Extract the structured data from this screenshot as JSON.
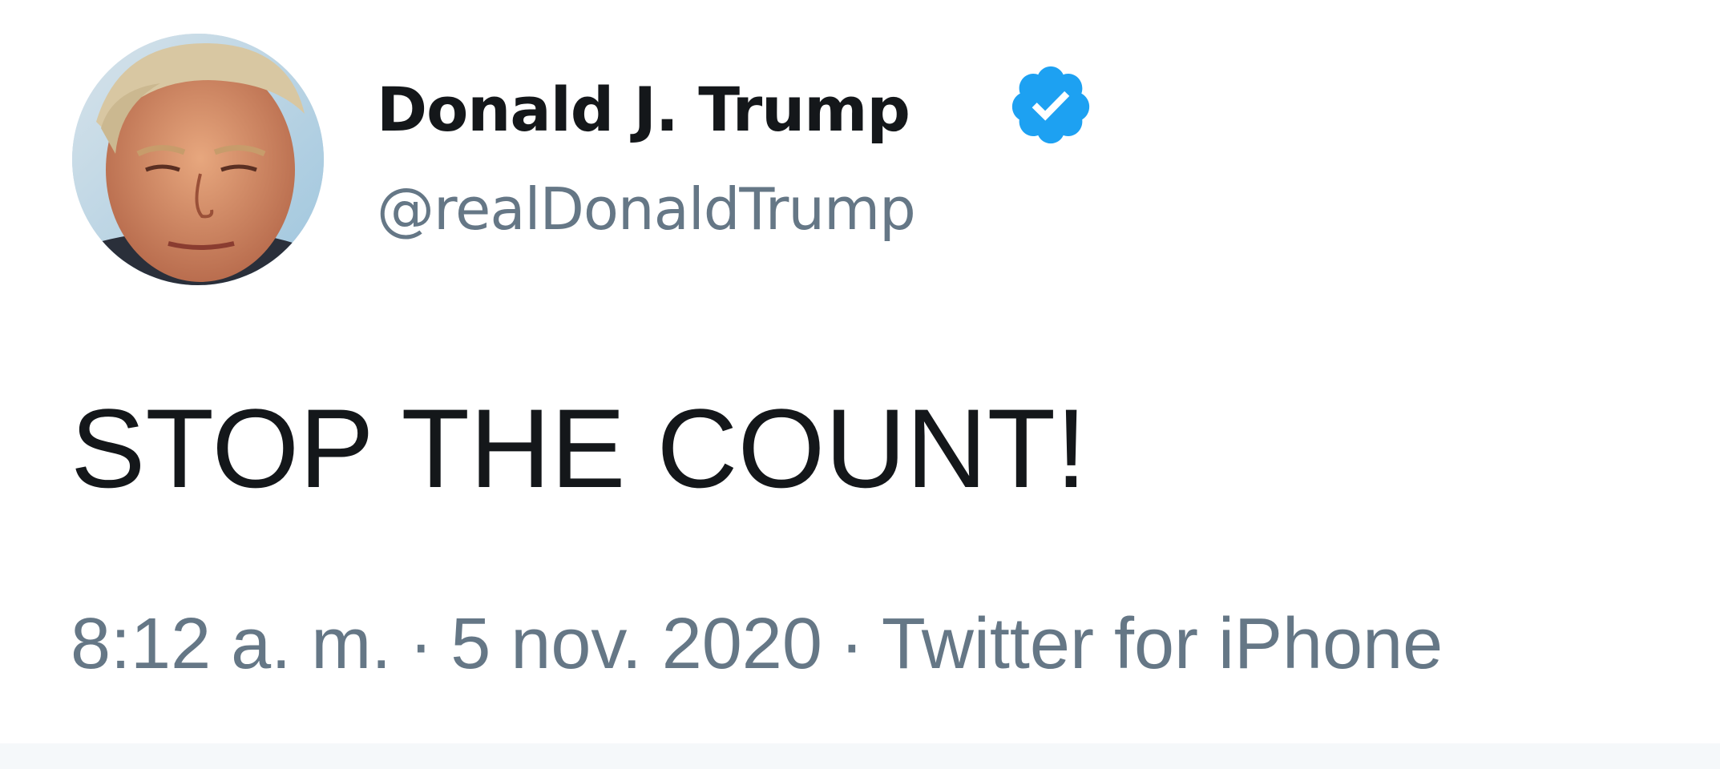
{
  "author": {
    "display_name": "Donald J. Trump",
    "handle": "@realDonaldTrump",
    "verified": true,
    "verified_badge_icon": "verified-badge-icon",
    "avatar_icon": "profile-photo"
  },
  "tweet": {
    "text": "STOP THE COUNT!",
    "time": "8:12 a. m.",
    "date": "5 nov. 2020",
    "source": "Twitter for iPhone",
    "separator": "·"
  },
  "colors": {
    "text_primary": "#14171a",
    "text_secondary": "#657786",
    "verified_blue": "#1da1f2",
    "background": "#ffffff"
  }
}
